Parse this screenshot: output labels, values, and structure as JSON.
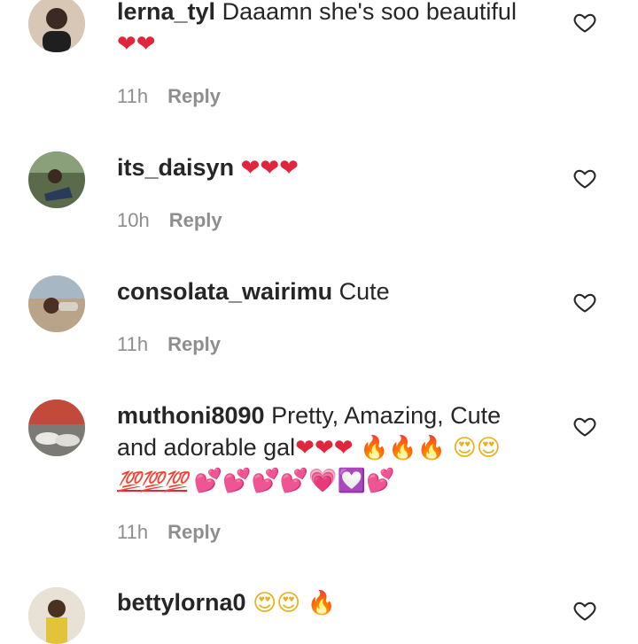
{
  "colors": {
    "text": "#262626",
    "meta": "#8e8e8e",
    "heart": "#e0263c",
    "fire": "#f06a1c"
  },
  "comments": [
    {
      "username": "lerna_tyl",
      "text": "Daaamn she's soo beautiful",
      "emojis": "❤❤",
      "time": "11h",
      "reply": "Reply"
    },
    {
      "username": "its_daisyn",
      "text": "",
      "emojis": "❤❤❤",
      "time": "10h",
      "reply": "Reply"
    },
    {
      "username": "consolata_wairimu",
      "text": "Cute",
      "emojis": "",
      "time": "11h",
      "reply": "Reply"
    },
    {
      "username": "muthoni8090",
      "text": "Pretty, Amazing, Cute and adorable gal",
      "emojis_hearts": "❤❤❤",
      "emojis_fire": "🔥🔥🔥",
      "emojis_face": "😍😍",
      "emojis_hundred": "💯💯💯",
      "emojis_pink": "💕💕💕💕💗💟💕",
      "time": "11h",
      "reply": "Reply"
    },
    {
      "username": "bettylorna0",
      "emojis_face": "😍😍",
      "emojis_fire": "🔥"
    }
  ],
  "icons": {
    "like": "heart-outline-icon"
  }
}
